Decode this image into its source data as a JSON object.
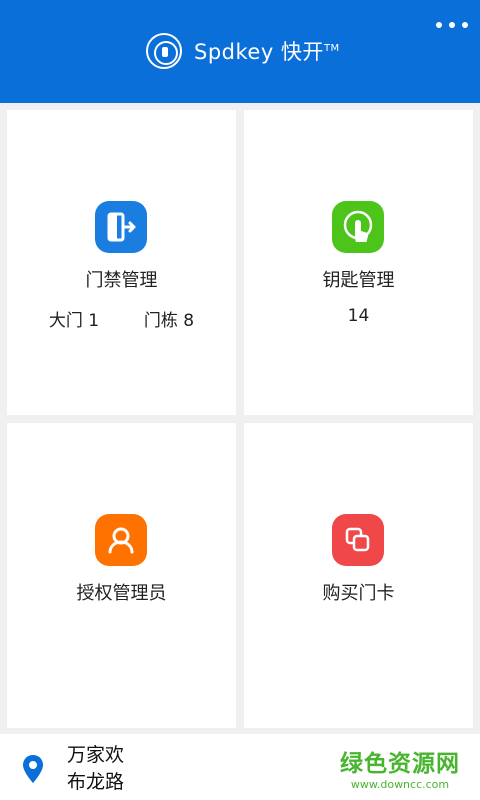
{
  "header": {
    "title": "Spdkey 快开",
    "tm": "TM",
    "bg_color": "#0a6fd8",
    "icons": {
      "logo": "lock-circle-logo-icon",
      "menu": "more-horizontal-icon"
    }
  },
  "tiles": [
    {
      "label": "门禁管理",
      "sub_left": "大门 1",
      "sub_right": "门栋 8",
      "icon": "door-exit-icon",
      "color": "#1a7ee0"
    },
    {
      "label": "钥匙管理",
      "count": "14",
      "icon": "touch-hand-icon",
      "color": "#4cc41a"
    },
    {
      "label": "授权管理员",
      "icon": "person-icon",
      "color": "#ff7200"
    },
    {
      "label": "购买门卡",
      "icon": "cards-icon",
      "color": "#f04848"
    }
  ],
  "footer": {
    "address_line1": "万家欢",
    "address_line2": "布龙路",
    "pin_icon": "location-pin-icon",
    "pin_color": "#0a6fd8"
  },
  "watermark": {
    "main": "绿色资源网",
    "sub": "www.downcc.com",
    "color": "#49b52f"
  }
}
